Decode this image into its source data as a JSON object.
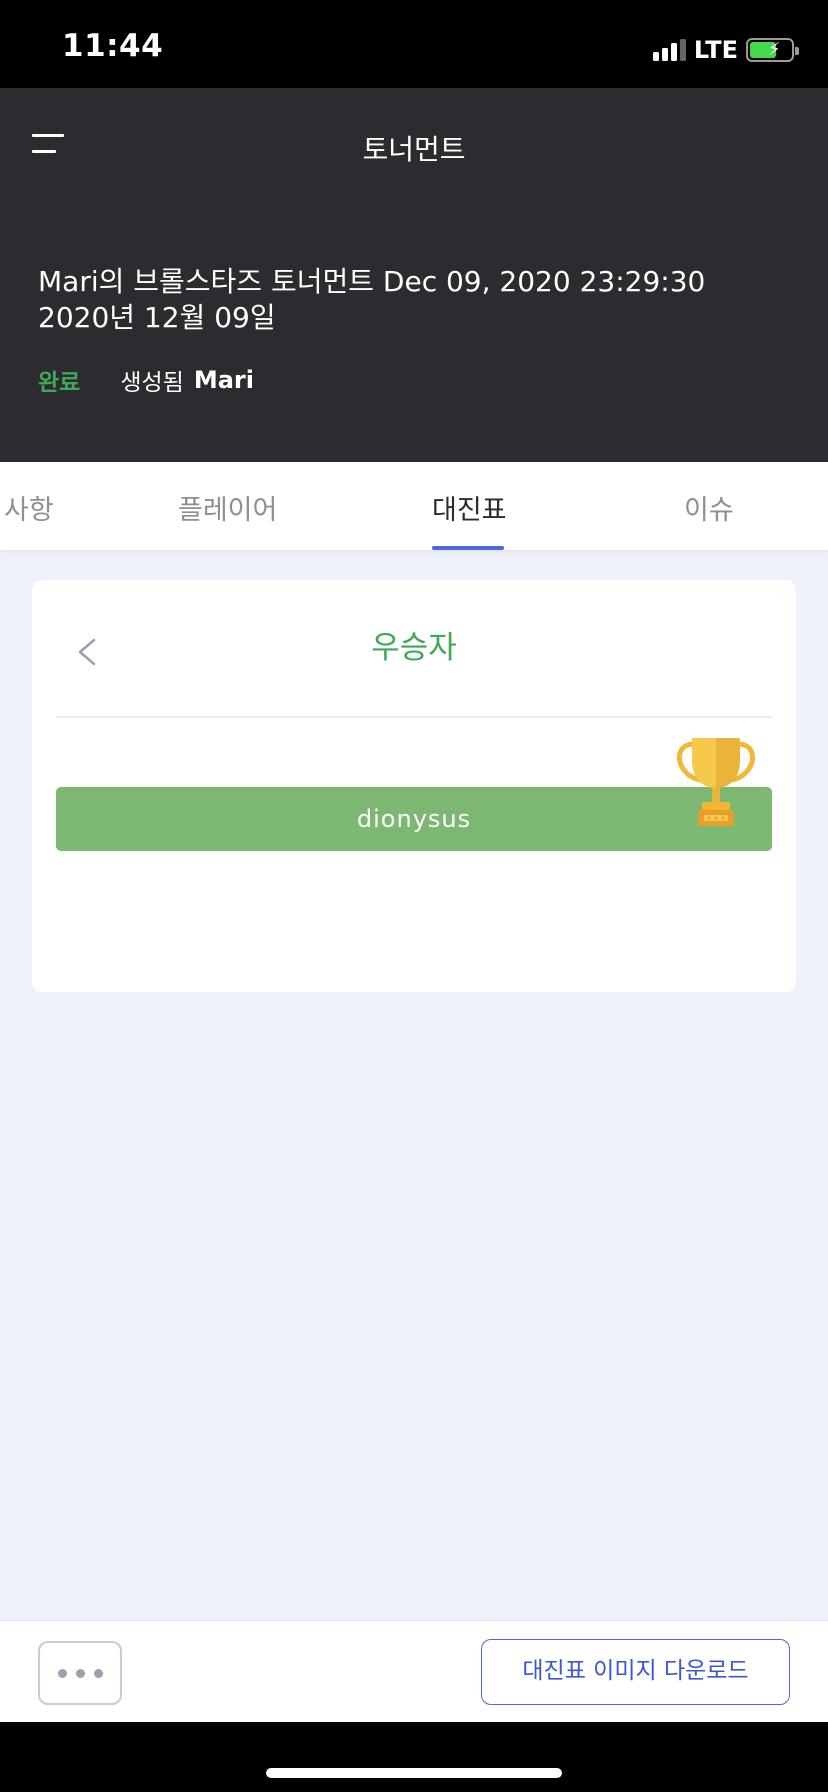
{
  "status_bar": {
    "time": "11:44",
    "network": "LTE"
  },
  "header": {
    "title": "토너먼트",
    "tournament_title": "Mari의 브롤스타즈 토너먼트 Dec 09, 2020 23:29:30",
    "tournament_date": "2020년 12월 09일",
    "status": "완료",
    "created_label": "생성됨",
    "creator": "Mari"
  },
  "tabs": [
    {
      "label": "사항",
      "active": false
    },
    {
      "label": "플레이어",
      "active": false
    },
    {
      "label": "대진표",
      "active": true
    },
    {
      "label": "이슈",
      "active": false
    }
  ],
  "card": {
    "title": "우승자",
    "winner": "dionysus"
  },
  "bottom_bar": {
    "download_label": "대진표 이미지 다운로드"
  },
  "colors": {
    "accent_green": "#3fa856",
    "winner_bar": "#7cb872",
    "accent_blue": "#4f67e3",
    "header_bg": "#2c2c30"
  }
}
